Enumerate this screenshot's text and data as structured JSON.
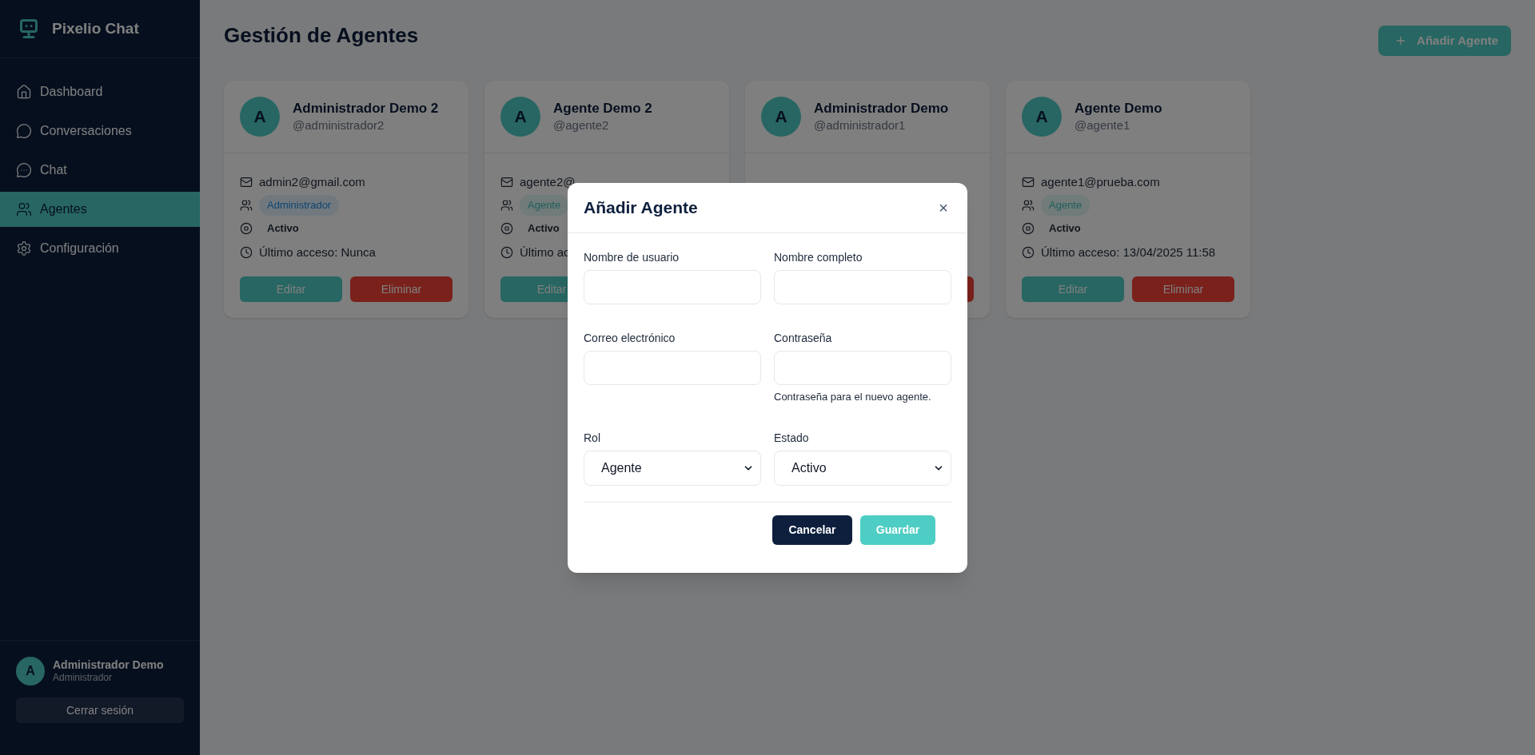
{
  "sidebar": {
    "brand": "Pixelio Chat",
    "nav": [
      {
        "label": "Dashboard",
        "selected": false
      },
      {
        "label": "Conversaciones",
        "selected": false
      },
      {
        "label": "Chat",
        "selected": false
      },
      {
        "label": "Agentes",
        "selected": true
      },
      {
        "label": "Configuración",
        "selected": false
      }
    ],
    "user": {
      "initial": "A",
      "name": "Administrador Demo",
      "role": "Administrador"
    },
    "logout": "Cerrar sesión"
  },
  "header": {
    "title": "Gestión de Agentes",
    "add_button": "Añadir Agente"
  },
  "agents": [
    {
      "initial": "A",
      "name": "Administrador Demo 2",
      "username": "@administrador2",
      "email": "admin2@gmail.com",
      "role": {
        "label": "Administrador",
        "kind": "admin"
      },
      "status": "Activo",
      "last_access": "Último acceso: Nunca",
      "buttons": [
        {
          "label": "Editar",
          "kind": "edit"
        },
        {
          "label": "Eliminar",
          "kind": "delete"
        }
      ]
    },
    {
      "initial": "A",
      "name": "Agente Demo 2",
      "username": "@agente2",
      "email": "agente2@",
      "role": {
        "label": "Agente",
        "kind": "agent"
      },
      "status": "Activo",
      "last_access": "Último ac",
      "buttons": [
        {
          "label": "Editar",
          "kind": "edit"
        }
      ]
    },
    {
      "initial": "A",
      "name": "Administrador Demo",
      "username": "@administrador1",
      "buttons": [
        {
          "kind": "delete"
        }
      ]
    },
    {
      "initial": "A",
      "name": "Agente Demo",
      "username": "@agente1",
      "email": "agente1@prueba.com",
      "role": {
        "label": "Agente",
        "kind": "agent"
      },
      "status": "Activo",
      "last_access": "Último acceso: 13/04/2025 11:58",
      "buttons": [
        {
          "label": "Editar",
          "kind": "edit"
        },
        {
          "label": "Eliminar",
          "kind": "delete"
        }
      ]
    }
  ],
  "modal": {
    "title": "Añadir Agente",
    "close": "×",
    "fields": [
      {
        "label": "Nombre de usuario",
        "kind": "text"
      },
      {
        "label": "Nombre completo",
        "kind": "text"
      },
      {
        "label": "Correo electrónico",
        "kind": "text"
      },
      {
        "label": "Contraseña",
        "kind": "text",
        "hint": "Contraseña para el nuevo agente."
      },
      {
        "label": "Rol",
        "kind": "select",
        "value": "Agente"
      },
      {
        "label": "Estado",
        "kind": "select",
        "value": "Activo"
      }
    ],
    "buttons": [
      {
        "label": "Cancelar",
        "kind": "secondary"
      },
      {
        "label": "Guardar",
        "kind": "primary"
      }
    ]
  }
}
